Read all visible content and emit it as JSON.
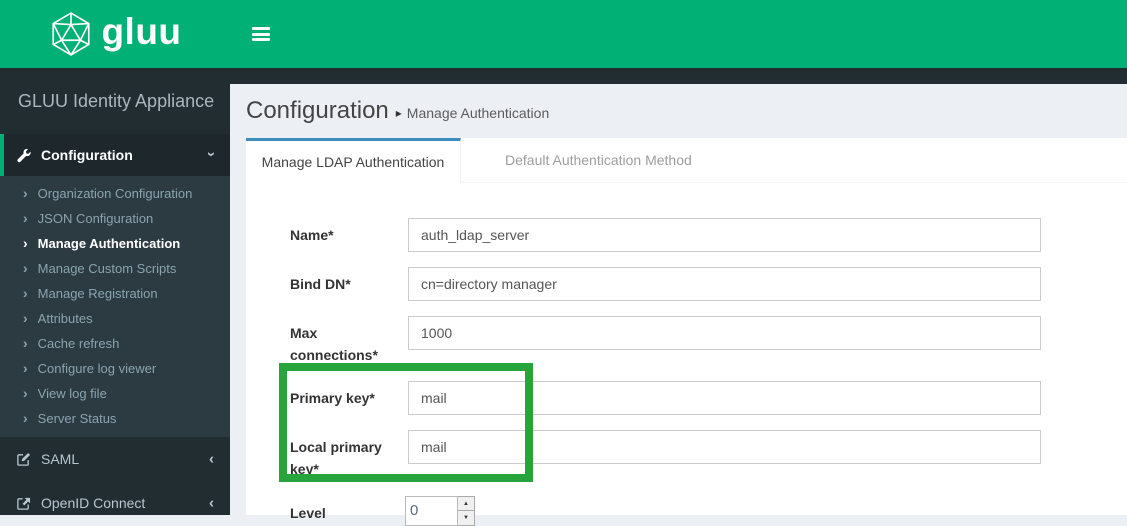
{
  "brand": {
    "name": "gluu"
  },
  "topbar": {
    "menu_toggle_icon": "hamburger-icon"
  },
  "sidebar": {
    "title": "GLUU Identity Appliance",
    "menu": [
      {
        "label": "Configuration",
        "icon": "wrench-icon",
        "state": "expanded",
        "active": true,
        "children": [
          "Organization Configuration",
          "JSON Configuration",
          "Manage Authentication",
          "Manage Custom Scripts",
          "Manage Registration",
          "Attributes",
          "Cache refresh",
          "Configure log viewer",
          "View log file",
          "Server Status"
        ],
        "active_child": "Manage Authentication"
      },
      {
        "label": "SAML",
        "icon": "edit-square-icon",
        "state": "collapsed"
      },
      {
        "label": "OpenID Connect",
        "icon": "external-link-icon",
        "state": "collapsed"
      }
    ]
  },
  "breadcrumb": {
    "section": "Configuration",
    "separator": "▸",
    "page": "Manage Authentication"
  },
  "tabs": [
    {
      "label": "Manage LDAP Authentication",
      "active": true
    },
    {
      "label": "Default Authentication Method",
      "active": false
    }
  ],
  "form": {
    "fields": [
      {
        "label": "Name*",
        "value": "auth_ldap_server",
        "type": "text"
      },
      {
        "label": "Bind DN*",
        "value": "cn=directory manager",
        "type": "text"
      },
      {
        "label": "Max connections*",
        "value": "1000",
        "type": "text"
      },
      {
        "label": "Primary key*",
        "value": "mail",
        "type": "text",
        "highlighted": true
      },
      {
        "label": "Local primary key*",
        "value": "mail",
        "type": "text",
        "highlighted": true
      },
      {
        "label": "Level",
        "value": "0",
        "type": "spinner"
      }
    ]
  },
  "icons": {
    "chevron_right": "›",
    "chevron_left": "‹",
    "chevron_down": "›",
    "triangle_up": "▲",
    "triangle_down": "▼"
  },
  "annotation": {
    "type": "highlight-rectangle",
    "color": "#28a43c"
  },
  "colors": {
    "brand_green": "#00b074",
    "sidebar_dark": "#222d32",
    "submenu_dark": "#2c3b41",
    "tab_accent_blue": "#3c8dbc",
    "content_bg": "#ecf0f5",
    "annotation_green": "#28a43c"
  }
}
